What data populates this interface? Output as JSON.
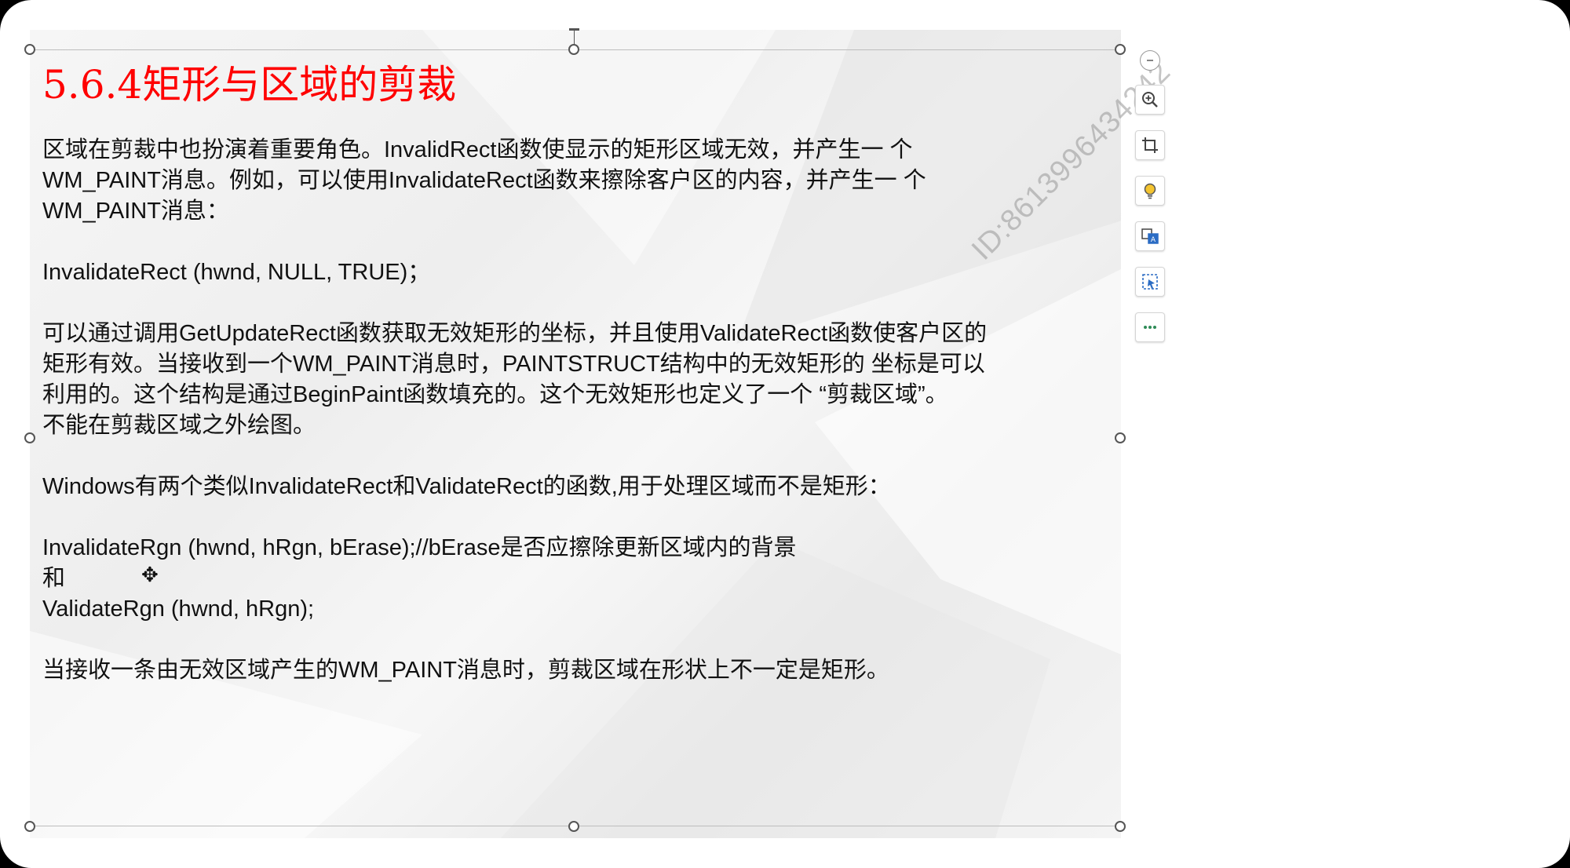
{
  "slide": {
    "title": "5.6.4矩形与区域的剪裁",
    "paragraphs": [
      {
        "lines": [
          "区域在剪裁中也扮演着重要角色。InvalidRect函数使显示的矩形区域无效，并产生一 个",
          "WM_PAINT消息。例如，可以使用InvalidateRect函数来擦除客户区的内容，并产生一 个",
          "WM_PAINT消息："
        ]
      },
      {
        "lines": [
          "InvalidateRect (hwnd, NULL, TRUE)；"
        ]
      },
      {
        "lines": [
          "可以通过调用GetUpdateRect函数获取无效矩形的坐标，并且使用ValidateRect函数使客户区的",
          "矩形有效。当接收到一个WM_PAINT消息时，PAINTSTRUCT结构中的无效矩形的 坐标是可以",
          "利用的。这个结构是通过BeginPaint函数填充的。这个无效矩形也定义了一个 “剪裁区域”。",
          "不能在剪裁区域之外绘图。"
        ]
      },
      {
        "lines": [
          "Windows有两个类似InvalidateRect和ValidateRect的函数,用于处理区域而不是矩形："
        ]
      },
      {
        "lines": [
          "InvalidateRgn (hwnd, hRgn, bErase);//bErase是否应擦除更新区域内的背景",
          "和",
          "ValidateRgn (hwnd, hRgn);"
        ]
      },
      {
        "lines": [
          "当接收一条由无效区域产生的WM_PAINT消息时，剪裁区域在形状上不一定是矩形。"
        ]
      }
    ],
    "watermark": "ID:8613996434242"
  },
  "toolbar": {
    "items": [
      {
        "name": "collapse",
        "icon": "minus-circle-icon"
      },
      {
        "name": "zoom",
        "icon": "zoom-in-icon"
      },
      {
        "name": "crop",
        "icon": "crop-icon"
      },
      {
        "name": "ideas",
        "icon": "lightbulb-icon"
      },
      {
        "name": "translate",
        "icon": "translate-icon"
      },
      {
        "name": "select",
        "icon": "select-icon"
      },
      {
        "name": "more",
        "icon": "more-icon"
      }
    ]
  },
  "colors": {
    "title": "#ff0000",
    "text": "#111111",
    "icon_blue": "#2b6cc4"
  }
}
